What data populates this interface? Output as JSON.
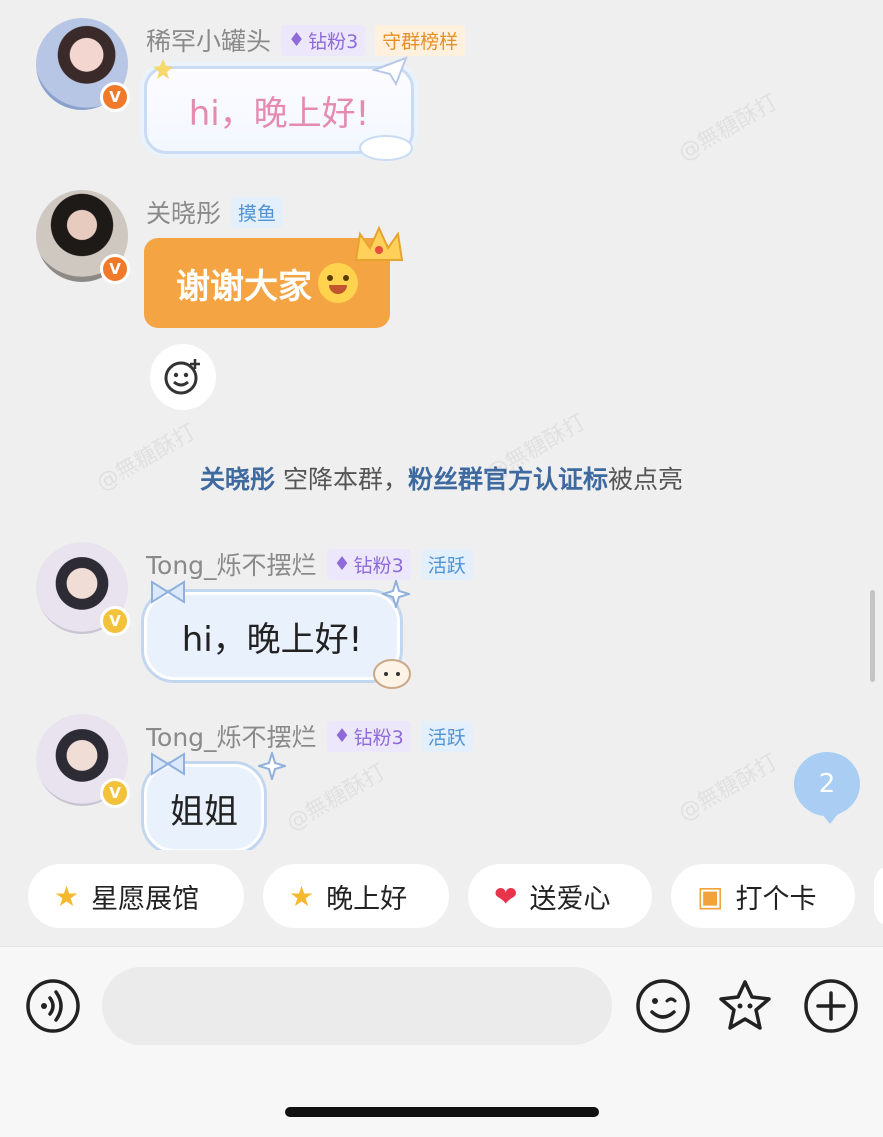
{
  "watermark": "@無糖酥打",
  "messages": [
    {
      "name": "稀罕小罐头",
      "badges": [
        "钻粉3",
        "守群榜样"
      ],
      "text": "hi，晚上好!"
    },
    {
      "name": "关晓彤",
      "badges": [
        "摸鱼"
      ],
      "text": "谢谢大家"
    },
    {
      "name": "Tong_烁不摆烂",
      "badges": [
        "钻粉3",
        "活跃"
      ],
      "text": "hi，晚上好!"
    },
    {
      "name": "Tong_烁不摆烂",
      "badges": [
        "钻粉3",
        "活跃"
      ],
      "text": "姐姐"
    }
  ],
  "system_notice": {
    "user": "关晓彤",
    "mid": " 空降本群，",
    "item": "粉丝群官方认证标",
    "tail": "被点亮"
  },
  "new_message_count": "2",
  "quick_replies": [
    {
      "label": "星愿展馆",
      "icon": "star-face-icon"
    },
    {
      "label": "晚上好",
      "icon": "star-face-icon"
    },
    {
      "label": "送爱心",
      "icon": "heart-icon"
    },
    {
      "label": "打个卡",
      "icon": "calendar-icon"
    }
  ],
  "input": {
    "placeholder": ""
  },
  "colors": {
    "background": "#efefef",
    "orange_bubble": "#f5a443",
    "pink_text": "#e58ab0",
    "blue_link": "#3e6aa0",
    "badge_blue": "#a9cdf3"
  }
}
